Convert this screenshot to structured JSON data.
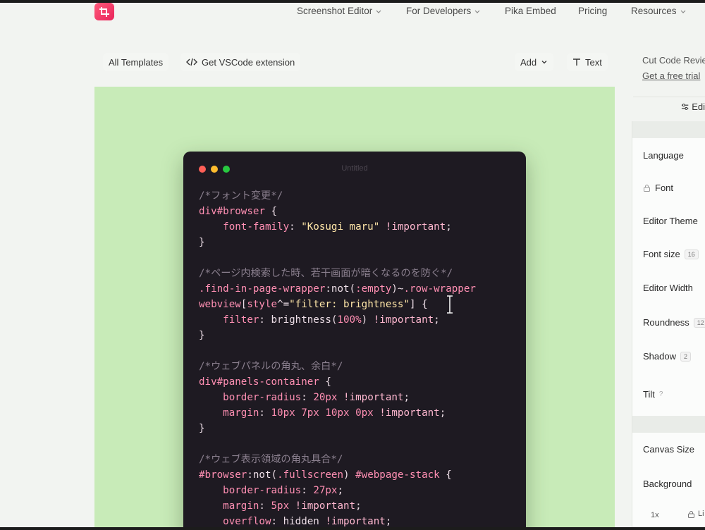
{
  "header": {
    "nav": [
      {
        "label": "Screenshot Editor",
        "dropdown": true
      },
      {
        "label": "For Developers",
        "dropdown": true
      },
      {
        "label": "Pika Embed",
        "dropdown": false
      },
      {
        "label": "Pricing",
        "dropdown": false
      },
      {
        "label": "Resources",
        "dropdown": true
      }
    ]
  },
  "toolbar": {
    "all_templates": "All Templates",
    "vscode": "Get VSCode extension",
    "add": "Add",
    "text": "Text"
  },
  "window": {
    "title": "Untitled",
    "dot_colors": [
      "#ff5f57",
      "#febc2e",
      "#28c840"
    ]
  },
  "code_lines": [
    [
      {
        "t": "/*フォント変更*/",
        "c": "cm"
      }
    ],
    [
      {
        "t": "div#browser",
        "c": "sel"
      },
      {
        "t": " {",
        "c": "pl"
      }
    ],
    [
      {
        "t": "    font-family",
        "c": "prop"
      },
      {
        "t": ": ",
        "c": "pl"
      },
      {
        "t": "\"Kosugi maru\"",
        "c": "str"
      },
      {
        "t": " !important",
        "c": "kw"
      },
      {
        "t": ";",
        "c": "pl"
      }
    ],
    [
      {
        "t": "}",
        "c": "pl"
      }
    ],
    [
      {
        "t": "",
        "c": "pl"
      }
    ],
    [
      {
        "t": "/*ページ内検索した時、若干画面が暗くなるのを防ぐ*/",
        "c": "cm"
      }
    ],
    [
      {
        "t": ".find-in-page-wrapper",
        "c": "sel"
      },
      {
        "t": ":not(",
        "c": "pl"
      },
      {
        "t": ":empty",
        "c": "sel"
      },
      {
        "t": ")~",
        "c": "pl"
      },
      {
        "t": ".row-wrapper",
        "c": "sel"
      }
    ],
    [
      {
        "t": "webview",
        "c": "sel"
      },
      {
        "t": "[",
        "c": "pl"
      },
      {
        "t": "style",
        "c": "sel"
      },
      {
        "t": "^=",
        "c": "pl"
      },
      {
        "t": "\"filter: brightness\"",
        "c": "str"
      },
      {
        "t": "] {",
        "c": "pl"
      }
    ],
    [
      {
        "t": "    filter",
        "c": "prop"
      },
      {
        "t": ": brightness(",
        "c": "pl"
      },
      {
        "t": "100%",
        "c": "num"
      },
      {
        "t": ") ",
        "c": "pl"
      },
      {
        "t": "!important",
        "c": "kw"
      },
      {
        "t": ";",
        "c": "pl"
      }
    ],
    [
      {
        "t": "}",
        "c": "pl"
      }
    ],
    [
      {
        "t": "",
        "c": "pl"
      }
    ],
    [
      {
        "t": "/*ウェブパネルの角丸、余白*/",
        "c": "cm"
      }
    ],
    [
      {
        "t": "div#panels-container",
        "c": "sel"
      },
      {
        "t": " {",
        "c": "pl"
      }
    ],
    [
      {
        "t": "    border-radius",
        "c": "prop"
      },
      {
        "t": ": ",
        "c": "pl"
      },
      {
        "t": "20px",
        "c": "num"
      },
      {
        "t": " !important",
        "c": "kw"
      },
      {
        "t": ";",
        "c": "pl"
      }
    ],
    [
      {
        "t": "    margin",
        "c": "prop"
      },
      {
        "t": ": ",
        "c": "pl"
      },
      {
        "t": "10px 7px 10px 0px",
        "c": "num"
      },
      {
        "t": " !important",
        "c": "kw"
      },
      {
        "t": ";",
        "c": "pl"
      }
    ],
    [
      {
        "t": "}",
        "c": "pl"
      }
    ],
    [
      {
        "t": "",
        "c": "pl"
      }
    ],
    [
      {
        "t": "/*ウェブ表示領域の角丸具合*/",
        "c": "cm"
      }
    ],
    [
      {
        "t": "#browser",
        "c": "sel"
      },
      {
        "t": ":not(",
        "c": "pl"
      },
      {
        "t": ".fullscreen",
        "c": "sel"
      },
      {
        "t": ") ",
        "c": "pl"
      },
      {
        "t": "#webpage-stack",
        "c": "sel"
      },
      {
        "t": " {",
        "c": "pl"
      }
    ],
    [
      {
        "t": "    border-radius",
        "c": "prop"
      },
      {
        "t": ": ",
        "c": "pl"
      },
      {
        "t": "27px",
        "c": "num"
      },
      {
        "t": ";",
        "c": "pl"
      }
    ],
    [
      {
        "t": "    margin",
        "c": "prop"
      },
      {
        "t": ": ",
        "c": "pl"
      },
      {
        "t": "5px",
        "c": "num"
      },
      {
        "t": " !important",
        "c": "kw"
      },
      {
        "t": ";",
        "c": "pl"
      }
    ],
    [
      {
        "t": "    overflow",
        "c": "prop"
      },
      {
        "t": ": hidden ",
        "c": "pl"
      },
      {
        "t": "!important",
        "c": "kw"
      },
      {
        "t": ";",
        "c": "pl"
      }
    ]
  ],
  "panel": {
    "promo_title": "Cut Code Revie",
    "promo_link": "Get a free trial",
    "edit_tab": "Edi",
    "settings": {
      "language": "Language",
      "font": "Font",
      "editor_theme": "Editor Theme",
      "font_size": "Font size",
      "font_size_value": "16",
      "editor_width": "Editor Width",
      "roundness": "Roundness",
      "roundness_value": "12",
      "shadow": "Shadow",
      "shadow_value": "2",
      "tilt": "Tilt",
      "tilt_help": "?",
      "canvas_size": "Canvas Size",
      "background": "Background"
    },
    "scale": "1x",
    "bottom_lock": "Li"
  },
  "colors": {
    "canvas_bg": "#c8ebb8",
    "window_bg": "#1e1a22",
    "brand": "#e8245a"
  }
}
